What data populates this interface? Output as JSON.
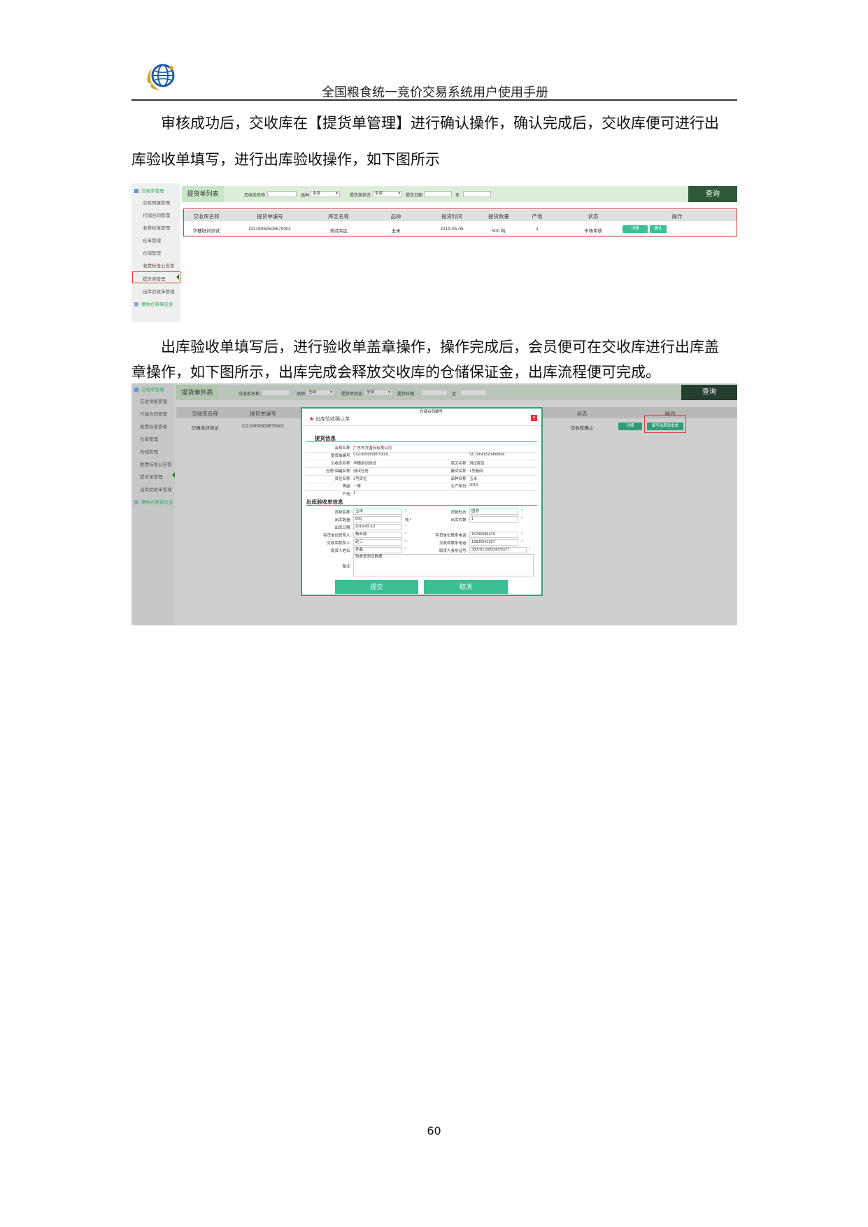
{
  "header": {
    "title": "全国粮食统一竞价交易系统用户使用手册"
  },
  "paragraph1": {
    "line1": "审核成功后，交收库在【提货单管理】进行确认操作，确认完成后，交收库便可进行出",
    "line2": "库验收单填写，进行出库验收操作，如下图所示"
  },
  "paragraph2": {
    "line1": "出库验收单填写后，进行验收单盖章操作，操作完成后，会员便可在交收库进行出库盖",
    "line2": "章操作，如下图所示，出库完成会释放交收库的仓储保证金，出库流程便可完成。"
  },
  "page_number": "60",
  "shot1": {
    "sidebar": {
      "head": "交收库管理",
      "items": [
        "交收预报管理",
        "代储合同管理",
        "收费标准管理",
        "仓单管理",
        "仓储管理",
        "收费标准公告管",
        "提货单管理",
        "出库验收单管理"
      ],
      "footer": "缴纳仓容保证金"
    },
    "filter": {
      "tab": "提货单列表",
      "label_warehouse": "交收库名称",
      "label_variety": "品种",
      "variety_value": "全部",
      "label_status": "提货单状态",
      "status_value": "全部",
      "label_date": "提货日期",
      "label_to": "至",
      "query": "查询"
    },
    "table": {
      "headers": [
        "交收库名称",
        "提货单编号",
        "库区名称",
        "品种",
        "提货时间",
        "提货数量",
        "产地",
        "状态",
        "操作"
      ],
      "row": [
        "华穗培训测试",
        "CG19050508570001",
        "测试库区",
        "玉米",
        "2019-05-05",
        "500 吨",
        "1",
        "市场审核"
      ],
      "btn_detail": "详情",
      "btn_confirm": "确认"
    }
  },
  "shot2": {
    "sidebar": {
      "head": "交收库管理",
      "items": [
        "交收预报管理",
        "代储合同管理",
        "收费标准管理",
        "仓单管理",
        "仓储管理",
        "收费标准公告管",
        "提货单管理",
        "出库验收单管理"
      ],
      "footer": "缴纳仓容保证金"
    },
    "filter": {
      "tab": "提货单列表",
      "label_warehouse": "交收库名称",
      "label_variety": "品种",
      "variety_value": "全部",
      "label_status": "提货单状态",
      "status_value": "全部",
      "label_date": "提货日期",
      "label_to": "至",
      "query": "查询"
    },
    "table": {
      "headers": [
        "交收库名称",
        "提货单编号",
        "状态",
        "操作"
      ],
      "row": [
        "华穗培训测试",
        "CG19050508570001",
        "交收库确认"
      ],
      "btn_detail": "详情",
      "btn_fill": "填写出库验收单"
    },
    "modal": {
      "title": "出库验收确认单",
      "section1": "提货信息",
      "member_label": "会员名称:",
      "member": "广东东方国际有限公司",
      "bill_label": "提货单编号:",
      "bill": "CG19050508570001",
      "contract_label": "仓储合同编号:",
      "contract": "SC19041520490004",
      "wh_label": "交收库名称:",
      "wh": "华穗培训测试",
      "area_label": "库区名称:",
      "area": "测试库区",
      "store_label": "仓房/油罐名称:",
      "store": "测试仓房",
      "tank_label": "廒间名称:",
      "tank": "1号廒间",
      "cargo_label": "货位名称:",
      "cargo": "1号货位",
      "variety_label": "品种名称:",
      "variety": "玉米",
      "grade_label": "等级:",
      "grade": "一等",
      "year_label": "生产年份:",
      "year": "2013",
      "origin_label": "产地:",
      "origin": "1",
      "section2": "出库验收单信息",
      "goods_label": "货物名称:",
      "goods": "玉米",
      "form_label": "货物形态:",
      "form": "固态",
      "qty_label": "出库数量:",
      "qty": "500",
      "qty_unit": "吨 *",
      "pieces_label": "出库件数:",
      "pieces": "1",
      "date_label": "出库日期:",
      "date": "2019-05-13",
      "storer_label": "存货单位联系人:",
      "storer": "杨业丽",
      "storer_phone_label": "存货单位联系电话:",
      "storer_phone": "15236686410",
      "whc_label": "交收库联系人:",
      "whc": "赵三",
      "whc_phone_label": "交收库联系电话:",
      "whc_phone": "18836541257",
      "picker_label": "取货人姓名:",
      "picker": "孙晶",
      "picker_id_label": "取货人身份证号:",
      "picker_id": "330781198509076577",
      "remark_label": "备注:",
      "remark": "验收单测试数据",
      "star": "*",
      "submit": "提交",
      "cancel": "取消"
    }
  }
}
